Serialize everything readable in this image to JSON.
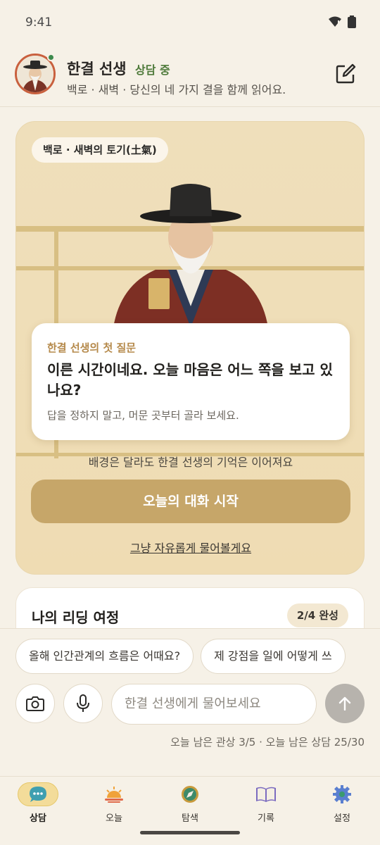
{
  "status_bar": {
    "time": "9:41"
  },
  "header": {
    "name": "한결 선생",
    "status": "상담 중",
    "subtitle": "백로 · 새벽 · 당신의 네 가지 결을 함께 읽어요."
  },
  "hero": {
    "chip": "백로 · 새벽의 토기(土氣)",
    "question_label": "한결 선생의 첫 질문",
    "question": "이른 시간이네요. 오늘 마음은 어느 쪽을 보고 있나요?",
    "question_hint": "답을 정하지 말고, 머문 곳부터 골라 보세요.",
    "memory_note": "배경은 달라도 한결 선생의 기억은 이어져요",
    "start_button": "오늘의 대화 시작",
    "free_link": "그냥 자유롭게 물어볼게요"
  },
  "journey": {
    "title": "나의 리딩 여정",
    "progress_badge": "2/4 완성"
  },
  "suggestions": [
    "올해 인간관계의 흐름은 어때요?",
    "제 강점을 일에 어떻게 쓰"
  ],
  "composer": {
    "placeholder": "한결 선생에게 물어보세요",
    "quota_text": "오늘 남은 관상 3/5 · 오늘 남은 상담 25/30"
  },
  "nav": {
    "items": [
      {
        "label": "상담",
        "icon": "chat-icon",
        "active": true
      },
      {
        "label": "오늘",
        "icon": "sunrise-icon",
        "active": false
      },
      {
        "label": "탐색",
        "icon": "compass-icon",
        "active": false
      },
      {
        "label": "기록",
        "icon": "book-icon",
        "active": false
      },
      {
        "label": "설정",
        "icon": "gear-icon",
        "active": false
      }
    ]
  },
  "colors": {
    "accent": "#c6a669",
    "background": "#f6f1e7",
    "status_green": "#4e7a3a",
    "avatar_ring": "#c9603e"
  }
}
